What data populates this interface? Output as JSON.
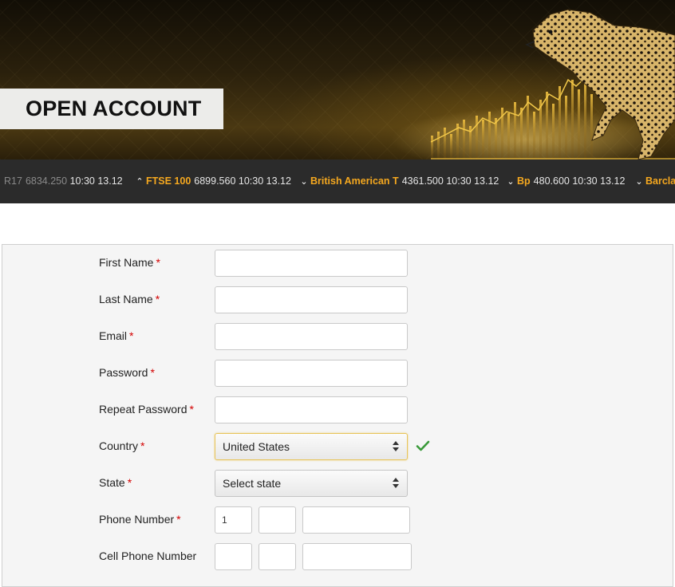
{
  "header": {
    "title": "OPEN ACCOUNT"
  },
  "ticker": [
    {
      "direction": "",
      "name": "R17",
      "value": "6834.250",
      "time": "10:30",
      "date": "13.12",
      "faded": true
    },
    {
      "direction": "up",
      "name": "FTSE 100",
      "value": "6899.560",
      "time": "10:30",
      "date": "13.12"
    },
    {
      "direction": "down",
      "name": "British American T",
      "value": "4361.500",
      "time": "10:30",
      "date": "13.12"
    },
    {
      "direction": "down",
      "name": "Bp",
      "value": "480.600",
      "time": "10:30",
      "date": "13.12"
    },
    {
      "direction": "down",
      "name": "Barcla",
      "value": "",
      "time": "",
      "date": ""
    }
  ],
  "form": {
    "required_mark": "*",
    "first_name": {
      "label": "First Name",
      "value": ""
    },
    "last_name": {
      "label": "Last Name",
      "value": ""
    },
    "email": {
      "label": "Email",
      "value": ""
    },
    "password": {
      "label": "Password",
      "value": ""
    },
    "repeat_password": {
      "label": "Repeat Password",
      "value": ""
    },
    "country": {
      "label": "Country",
      "selected": "United States",
      "valid_icon": "checkmark-icon"
    },
    "state": {
      "label": "State",
      "selected": "Select state"
    },
    "phone": {
      "label": "Phone Number",
      "country_code": "1",
      "area_code": "",
      "number": ""
    },
    "cell_phone": {
      "label": "Cell Phone Number",
      "country_code": "",
      "area_code": "",
      "number": ""
    }
  },
  "colors": {
    "accent": "#f5a81f",
    "required": "#d30000",
    "valid": "#3a9a3a",
    "ticker_bg": "#2b2b2b"
  }
}
